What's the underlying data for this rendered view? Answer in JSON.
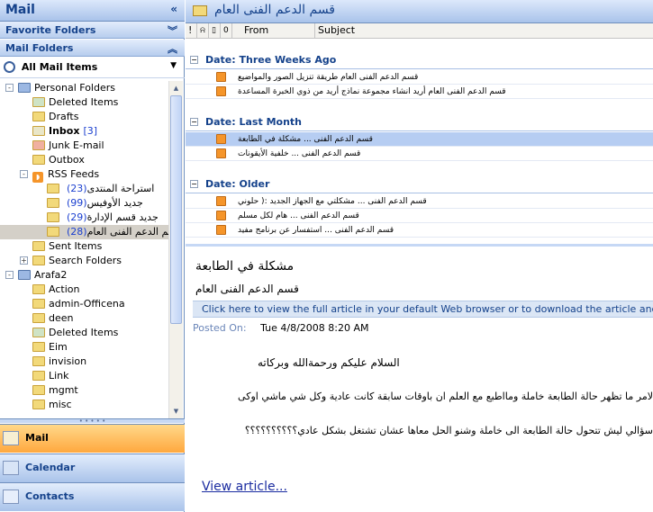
{
  "nav": {
    "title": "Mail",
    "collapse_glyph": "«",
    "favorite_folders": "Favorite Folders",
    "mail_folders": "Mail Folders",
    "all_mail_items": "All Mail Items",
    "tree": [
      {
        "label": "Personal Folders",
        "level": 0,
        "expand": "-",
        "icon": "personal-folders-icon"
      },
      {
        "label": "Deleted Items",
        "level": 1,
        "icon": "deleted-items-icon"
      },
      {
        "label": "Drafts",
        "level": 1,
        "icon": "drafts-icon"
      },
      {
        "label": "Inbox",
        "level": 1,
        "icon": "inbox-icon",
        "bold": true,
        "count": "[3]"
      },
      {
        "label": "Junk E-mail",
        "level": 1,
        "icon": "junk-icon"
      },
      {
        "label": "Outbox",
        "level": 1,
        "icon": "outbox-icon"
      },
      {
        "label": "RSS Feeds",
        "level": 1,
        "expand": "-",
        "icon": "rss-icon"
      },
      {
        "label": "استراحة المنتدى",
        "level": 2,
        "icon": "folder-icon",
        "count": "(23)"
      },
      {
        "label": "جديد الأوفيس",
        "level": 2,
        "icon": "folder-icon",
        "count": "(99)"
      },
      {
        "label": "جديد قسم الإدارة",
        "level": 2,
        "icon": "folder-icon",
        "count": "(29)"
      },
      {
        "label": "قسم الدعم الفنى العام",
        "level": 2,
        "icon": "folder-icon",
        "count": "(28)",
        "selected": true
      },
      {
        "label": "Sent Items",
        "level": 1,
        "icon": "sent-items-icon"
      },
      {
        "label": "Search Folders",
        "level": 1,
        "expand": "+",
        "icon": "search-folders-icon"
      },
      {
        "label": "Arafa2",
        "level": 0,
        "expand": "-",
        "icon": "mailbox-icon"
      },
      {
        "label": "Action",
        "level": 1,
        "icon": "folder-icon"
      },
      {
        "label": "admin-Officena",
        "level": 1,
        "icon": "folder-icon"
      },
      {
        "label": "deen",
        "level": 1,
        "icon": "folder-icon"
      },
      {
        "label": "Deleted Items",
        "level": 1,
        "icon": "deleted-items-icon"
      },
      {
        "label": "Eim",
        "level": 1,
        "icon": "folder-icon"
      },
      {
        "label": "invision",
        "level": 1,
        "icon": "folder-icon"
      },
      {
        "label": "Link",
        "level": 1,
        "icon": "folder-icon"
      },
      {
        "label": "mgmt",
        "level": 1,
        "icon": "folder-icon"
      },
      {
        "label": "misc",
        "level": 1,
        "icon": "folder-icon"
      }
    ],
    "buttons": [
      {
        "label": "Mail",
        "icon": "mail-icon",
        "active": true
      },
      {
        "label": "Calendar",
        "icon": "calendar-icon",
        "active": false
      },
      {
        "label": "Contacts",
        "icon": "contacts-icon",
        "active": false
      }
    ]
  },
  "folder_header": "قسم الدعم الفنى العام",
  "columns": {
    "importance": "!",
    "reminder": "⍾",
    "type": "▯",
    "attachment": "0",
    "from": "From",
    "subject": "Subject"
  },
  "groups": [
    {
      "label": "Date: Three Weeks Ago",
      "items": [
        {
          "from": "قسم الدعم الفنى العام",
          "subject": "طريقة تنزيل الصور والمواضيع"
        },
        {
          "from": "قسم الدعم الفنى العام",
          "subject": "أريد انشاء مجموعة نماذج أريد من ذوي الخبرة المساعدة"
        }
      ]
    },
    {
      "label": "Date: Last Month",
      "items": [
        {
          "from": "قسم الدعم الفنى ...",
          "subject": "مشكلة في الطابعة",
          "selected": true
        },
        {
          "from": "قسم الدعم الفنى ...",
          "subject": "خلفية الأيقونات"
        }
      ]
    },
    {
      "label": "Date: Older",
      "items": [
        {
          "from": "قسم الدعم الفنى ...",
          "subject": "مشكلتي مع الجهاز الجديد :( حلوني"
        },
        {
          "from": "قسم الدعم الفنى ...",
          "subject": "هام لكل مسلم"
        },
        {
          "from": "قسم الدعم الفنى ...",
          "subject": "استفسار عن برنامج مفيد"
        }
      ]
    }
  ],
  "reading": {
    "subject": "مشكلة في الطابعة",
    "from": "قسم الدعم الفنى العام",
    "info": "Click here to view the full article in your default Web browser or to download the article and any",
    "posted_label": "Posted On:",
    "posted_value": "Tue 4/8/2008 8:20 AM",
    "body": [
      "السلام عليكم ورحمةالله وبركاته",
      "لامر ما تظهر حالة الطابعة خاملة ومااطبع مع العلم ان باوقات سابقة كانت عادية وكل شي ماشي اوكى",
      "سؤالي ليش تتحول حالة الطابعة الى خاملة وشنو الحل معاها عشان تشتغل بشكل عادي؟؟؟؟؟؟؟؟؟؟"
    ],
    "view_article": "View article..."
  },
  "colors": {
    "accent": "#15428b",
    "selection": "#b6cdf2",
    "active_nav": "#ffc060"
  }
}
